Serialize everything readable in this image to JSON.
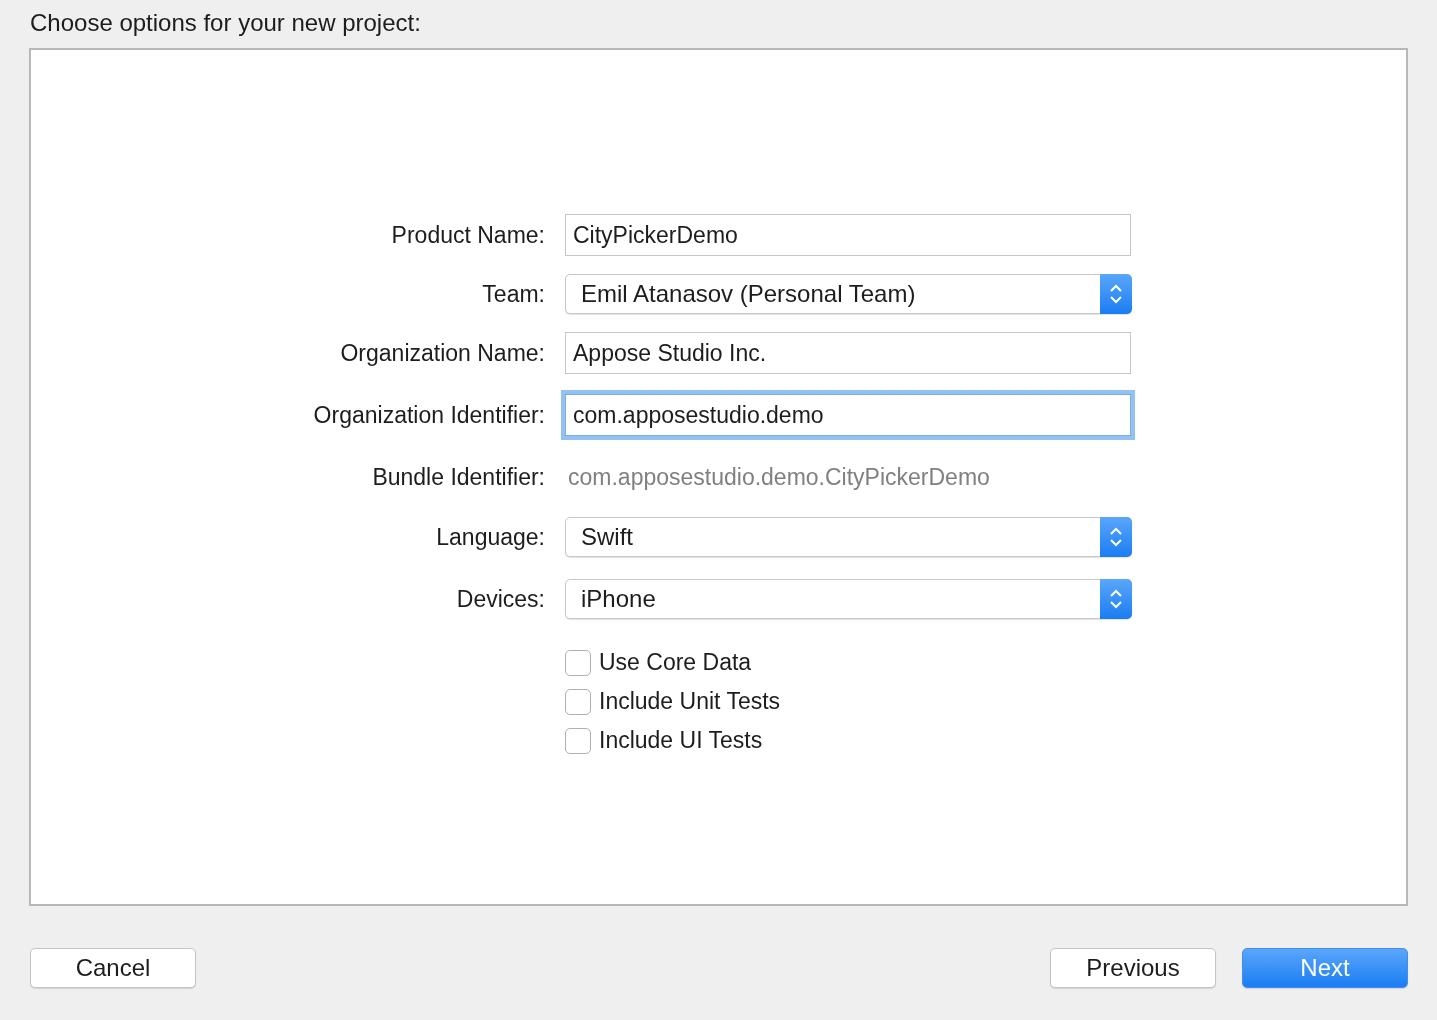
{
  "title": "Choose options for your new project:",
  "fields": [
    {
      "kind": "text",
      "label": "Product Name:",
      "value": "CityPickerDemo",
      "focused": false
    },
    {
      "kind": "popup",
      "label": "Team:",
      "value": "Emil Atanasov (Personal Team)"
    },
    {
      "kind": "text",
      "label": "Organization Name:",
      "value": "Appose Studio Inc.",
      "focused": false
    },
    {
      "kind": "text",
      "label": "Organization Identifier:",
      "value": "com.apposestudio.demo",
      "focused": true
    },
    {
      "kind": "static",
      "label": "Bundle Identifier:",
      "value": "com.apposestudio.demo.CityPickerDemo"
    },
    {
      "kind": "popup",
      "label": "Language:",
      "value": "Swift"
    },
    {
      "kind": "popup",
      "label": "Devices:",
      "value": "iPhone"
    }
  ],
  "checkboxes": [
    {
      "label": "Use Core Data",
      "checked": false
    },
    {
      "label": "Include Unit Tests",
      "checked": false
    },
    {
      "label": "Include UI Tests",
      "checked": false
    }
  ],
  "buttons": [
    {
      "label": "Cancel",
      "kind": "normal"
    },
    {
      "label": "Previous",
      "kind": "normal"
    },
    {
      "label": "Next",
      "kind": "default"
    }
  ]
}
